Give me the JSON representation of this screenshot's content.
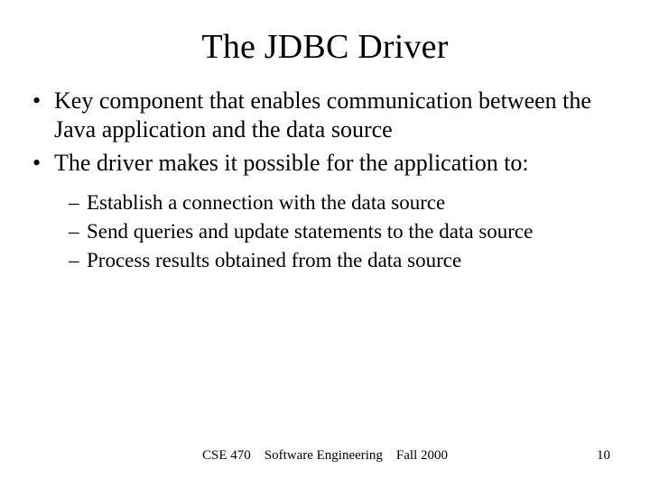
{
  "title": "The JDBC Driver",
  "bullets": {
    "b1": "Key component that enables communication between the Java application and the data source",
    "b2": "The driver makes it possible for the application to:",
    "sub": {
      "s1": "Establish a connection with the data source",
      "s2": "Send queries and update statements to the data source",
      "s3": "Process results obtained from the data source"
    }
  },
  "footer": "CSE 470 Software Engineering Fall 2000",
  "page_number": "10"
}
